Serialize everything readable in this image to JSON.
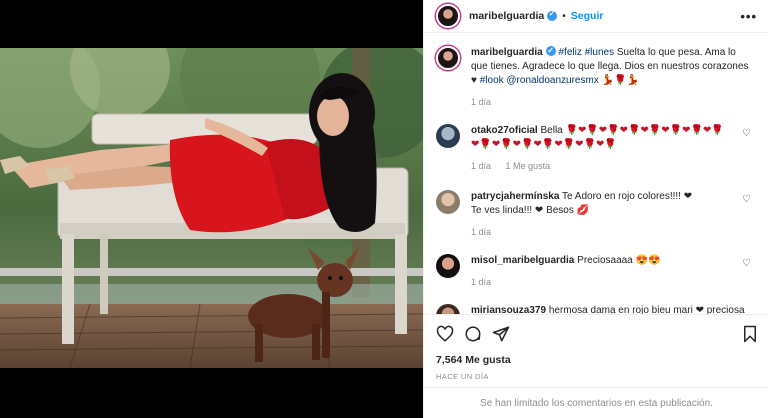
{
  "post": {
    "username": "maribelguardia",
    "follow_label": "Seguir",
    "separator": "•",
    "more_label": "•••"
  },
  "caption": {
    "username": "maribelguardia",
    "text_1": " ",
    "hashtag_feliz": "#feliz",
    "hashtag_lunes": "#lunes",
    "text_2": " Suelta lo que pesa. Ama lo que tienes. Agradece lo que llega. Dios en nuestros corazones ♥ ",
    "hashtag_look": "#look",
    "mention": "@ronaldoanzuresmx",
    "emojis": " 💃🌹💃",
    "time": "1 día"
  },
  "comments": [
    {
      "username": "otako27oficial",
      "text": "Bella",
      "emojis": "🌹❤🌹❤🌹❤🌹❤🌹❤🌹❤🌹❤🌹❤🌹❤🌹❤🌹❤🌹❤🌹❤🌹❤🌹",
      "time": "1 día",
      "likes": "1 Me gusta"
    },
    {
      "username": "patrycjahermínska",
      "text": "Te Adoro en rojo colores!!!! ❤",
      "text_2": "Te ves linda!!! ❤ Besos 💋",
      "time": "1 día"
    },
    {
      "username": "misol_maribelguardia",
      "text": "Preciosaaaa 😍😍",
      "time": "1 día"
    },
    {
      "username": "miriansouza379",
      "text": "hermosa dama en rojo bieu mari ❤ preciosa",
      "time": ""
    }
  ],
  "actions": {
    "likes": "7,564 Me gusta",
    "ago": "HACE UN DÍA",
    "limited": "Se han limitado los comentarios en esta publicación."
  },
  "colors": {
    "accent": "#0095f6",
    "verified": "#3897f0",
    "link": "#00376b",
    "muted": "#8e8e8e",
    "dress": "#d8141c"
  }
}
